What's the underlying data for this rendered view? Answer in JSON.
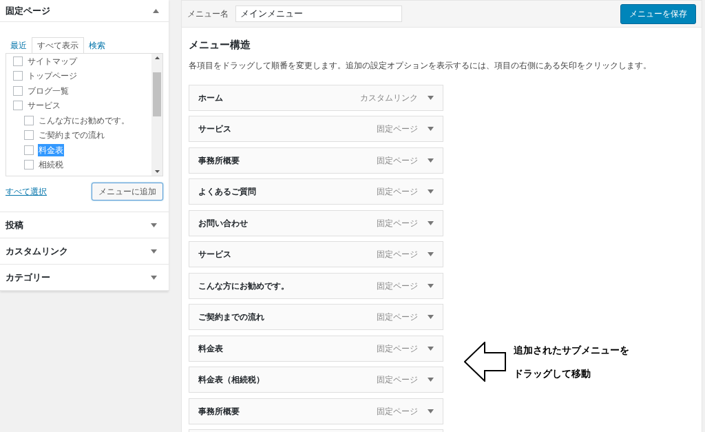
{
  "pages_box": {
    "title": "固定ページ",
    "expanded": true,
    "tabs": [
      {
        "label": "最近",
        "selected": false
      },
      {
        "label": "すべて表示",
        "selected": true
      },
      {
        "label": "検索",
        "selected": false
      }
    ],
    "items": [
      {
        "label": "サイトマップ",
        "checked": false,
        "highlighted": false
      },
      {
        "label": "トップページ",
        "checked": false,
        "highlighted": false
      },
      {
        "label": "ブログ一覧",
        "checked": false,
        "highlighted": false
      },
      {
        "label": "サービス",
        "checked": false,
        "highlighted": false,
        "children": [
          {
            "label": "こんな方にお勧めです。",
            "checked": false,
            "highlighted": false
          },
          {
            "label": "ご契約までの流れ",
            "checked": false,
            "highlighted": false
          },
          {
            "label": "料金表",
            "checked": false,
            "highlighted": true
          },
          {
            "label": "相続税",
            "checked": false,
            "highlighted": false
          }
        ]
      }
    ],
    "select_all": "すべて選択",
    "add_button": "メニューに追加"
  },
  "other_boxes": [
    {
      "title": "投稿",
      "expanded": false
    },
    {
      "title": "カスタムリンク",
      "expanded": false
    },
    {
      "title": "カテゴリー",
      "expanded": false
    }
  ],
  "menu_name": {
    "label": "メニュー名",
    "value": "メインメニュー"
  },
  "save_button": "メニューを保存",
  "structure": {
    "title": "メニュー構造",
    "description": "各項目をドラッグして順番を変更します。追加の設定オプションを表示するには、項目の右側にある矢印をクリックします。",
    "items": [
      {
        "label": "ホーム",
        "type": "カスタムリンク"
      },
      {
        "label": "サービス",
        "type": "固定ページ"
      },
      {
        "label": "事務所概要",
        "type": "固定ページ"
      },
      {
        "label": "よくあるご質問",
        "type": "固定ページ"
      },
      {
        "label": "お問い合わせ",
        "type": "固定ページ"
      },
      {
        "label": "サービス",
        "type": "固定ページ"
      },
      {
        "label": "こんな方にお勧めです。",
        "type": "固定ページ"
      },
      {
        "label": "ご契約までの流れ",
        "type": "固定ページ"
      },
      {
        "label": "料金表",
        "type": "固定ページ"
      },
      {
        "label": "料金表（相続税）",
        "type": "固定ページ"
      },
      {
        "label": "事務所概要",
        "type": "固定ページ"
      }
    ]
  },
  "annotation": {
    "lines": [
      "追加されたサブメニューを",
      "ドラッグして移動"
    ]
  }
}
